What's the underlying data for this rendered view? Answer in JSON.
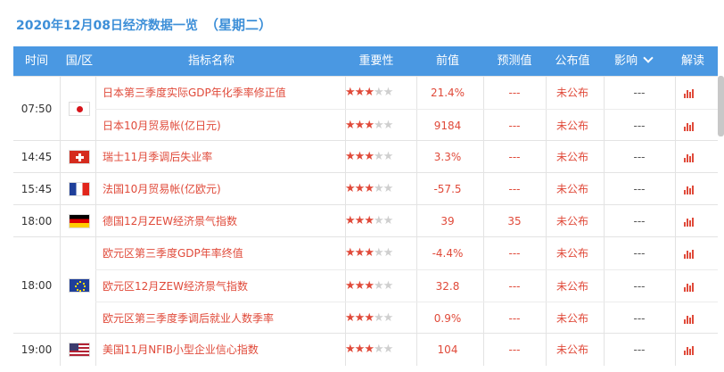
{
  "page": {
    "title_date": "2020年12月08日经济数据一览",
    "title_weekday": "（星期二）"
  },
  "header": {
    "time": "时间",
    "country": "国/区",
    "indicator": "指标名称",
    "importance": "重要性",
    "previous": "前值",
    "forecast": "预测值",
    "actual": "公布值",
    "effect": "影响",
    "interpret": "解读"
  },
  "groups": [
    {
      "time": "07:50",
      "flag": "jp-flag-icon",
      "rows": [
        {
          "name": "日本第三季度实际GDP年化季率修正值",
          "stars": 3,
          "previous": "21.4%",
          "forecast": "---",
          "actual": "未公布",
          "effect": "---"
        },
        {
          "name": "日本10月贸易帐(亿日元)",
          "stars": 3,
          "previous": "9184",
          "forecast": "---",
          "actual": "未公布",
          "effect": "---"
        }
      ]
    },
    {
      "time": "14:45",
      "flag": "ch-flag-icon",
      "rows": [
        {
          "name": "瑞士11月季调后失业率",
          "stars": 3,
          "previous": "3.3%",
          "forecast": "---",
          "actual": "未公布",
          "effect": "---"
        }
      ]
    },
    {
      "time": "15:45",
      "flag": "fr-flag-icon",
      "rows": [
        {
          "name": "法国10月贸易帐(亿欧元)",
          "stars": 3,
          "previous": "-57.5",
          "forecast": "---",
          "actual": "未公布",
          "effect": "---"
        }
      ]
    },
    {
      "time": "18:00",
      "flag": "de-flag-icon",
      "rows": [
        {
          "name": "德国12月ZEW经济景气指数",
          "stars": 3,
          "previous": "39",
          "forecast": "35",
          "actual": "未公布",
          "effect": "---"
        }
      ]
    },
    {
      "time": "18:00",
      "flag": "eu-flag-icon",
      "rows": [
        {
          "name": "欧元区第三季度GDP年率终值",
          "stars": 3,
          "previous": "-4.4%",
          "forecast": "---",
          "actual": "未公布",
          "effect": "---"
        },
        {
          "name": "欧元区12月ZEW经济景气指数",
          "stars": 3,
          "previous": "32.8",
          "forecast": "---",
          "actual": "未公布",
          "effect": "---"
        },
        {
          "name": "欧元区第三季度季调后就业人数季率",
          "stars": 3,
          "previous": "0.9%",
          "forecast": "---",
          "actual": "未公布",
          "effect": "---"
        }
      ]
    },
    {
      "time": "19:00",
      "flag": "us-flag-icon",
      "rows": [
        {
          "name": "美国11月NFIB小型企业信心指数",
          "stars": 3,
          "previous": "104",
          "forecast": "---",
          "actual": "未公布",
          "effect": "---"
        }
      ]
    }
  ],
  "icons": {
    "interpret": "bar-chart-icon",
    "effect_dropdown": "chevron-down-icon"
  },
  "colors": {
    "header_bg": "#4a98e2",
    "accent_red": "#e04a3a",
    "title_blue": "#3d8fd8"
  }
}
